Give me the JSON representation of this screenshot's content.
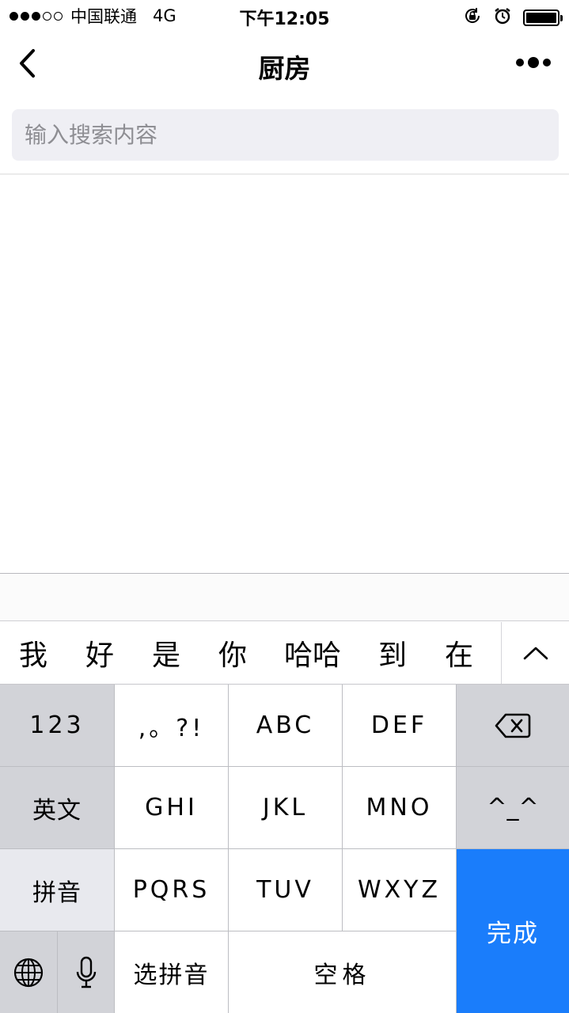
{
  "status_bar": {
    "carrier": "中国联通",
    "network": "4G",
    "time": "下午12:05"
  },
  "nav": {
    "title": "厨房"
  },
  "search": {
    "placeholder": "输入搜索内容",
    "value": ""
  },
  "candidates": [
    "我",
    "好",
    "是",
    "你",
    "哈哈",
    "到",
    "在"
  ],
  "keyboard": {
    "numbers": "123",
    "punct": ",。?!",
    "abc": "ABC",
    "def": "DEF",
    "english": "英文",
    "ghi": "GHI",
    "jkl": "JKL",
    "mno": "MNO",
    "emoticon": "^_^",
    "pinyin": "拼音",
    "pqrs": "PQRS",
    "tuv": "TUV",
    "wxyz": "WXYZ",
    "done": "完成",
    "select_pinyin": "选拼音",
    "space": "空格"
  },
  "colors": {
    "done_key": "#1a7dfb",
    "search_bg": "#efeff4"
  }
}
